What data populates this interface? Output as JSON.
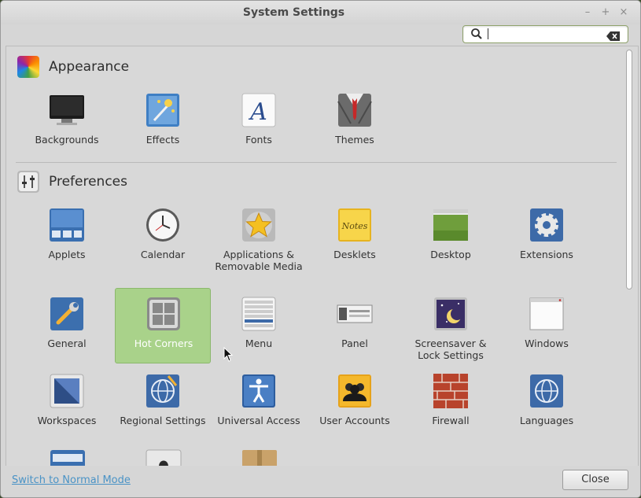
{
  "window": {
    "title": "System Settings",
    "controls": [
      "–",
      "+",
      "×"
    ]
  },
  "search": {
    "value": "",
    "placeholder": ""
  },
  "sections": [
    {
      "title": "Appearance",
      "icon": "color-wheel-icon",
      "items": [
        {
          "label": "Backgrounds",
          "icon": "monitor-icon"
        },
        {
          "label": "Effects",
          "icon": "magic-wand-icon"
        },
        {
          "label": "Fonts",
          "icon": "font-letter-icon"
        },
        {
          "label": "Themes",
          "icon": "suit-tie-icon"
        }
      ]
    },
    {
      "title": "Preferences",
      "icon": "sliders-icon",
      "items": [
        {
          "label": "Applets",
          "icon": "applets-icon"
        },
        {
          "label": "Calendar",
          "icon": "clock-icon"
        },
        {
          "label": "Applications & Removable Media",
          "icon": "star-media-icon"
        },
        {
          "label": "Desklets",
          "icon": "notes-icon"
        },
        {
          "label": "Desktop",
          "icon": "desktop-icon"
        },
        {
          "label": "Extensions",
          "icon": "gear-icon"
        },
        {
          "label": "General",
          "icon": "wrench-icon"
        },
        {
          "label": "Hot Corners",
          "icon": "hot-corners-icon",
          "selected": true
        },
        {
          "label": "Menu",
          "icon": "menu-list-icon"
        },
        {
          "label": "Panel",
          "icon": "panel-icon"
        },
        {
          "label": "Screensaver & Lock Settings",
          "icon": "moon-screensaver-icon"
        },
        {
          "label": "Windows",
          "icon": "window-icon"
        },
        {
          "label": "Workspaces",
          "icon": "workspaces-icon"
        },
        {
          "label": "Regional Settings",
          "icon": "globe-pencil-icon"
        },
        {
          "label": "Universal Access",
          "icon": "accessibility-icon"
        },
        {
          "label": "User Accounts",
          "icon": "users-icon"
        },
        {
          "label": "Firewall",
          "icon": "brick-wall-icon"
        },
        {
          "label": "Languages",
          "icon": "globe-icon"
        }
      ]
    }
  ],
  "footer": {
    "mode_link": "Switch to Normal Mode",
    "close_label": "Close"
  },
  "colors": {
    "selected_bg": "#a9d28a",
    "link": "#4a93c6",
    "search_border": "#8fa26c"
  }
}
